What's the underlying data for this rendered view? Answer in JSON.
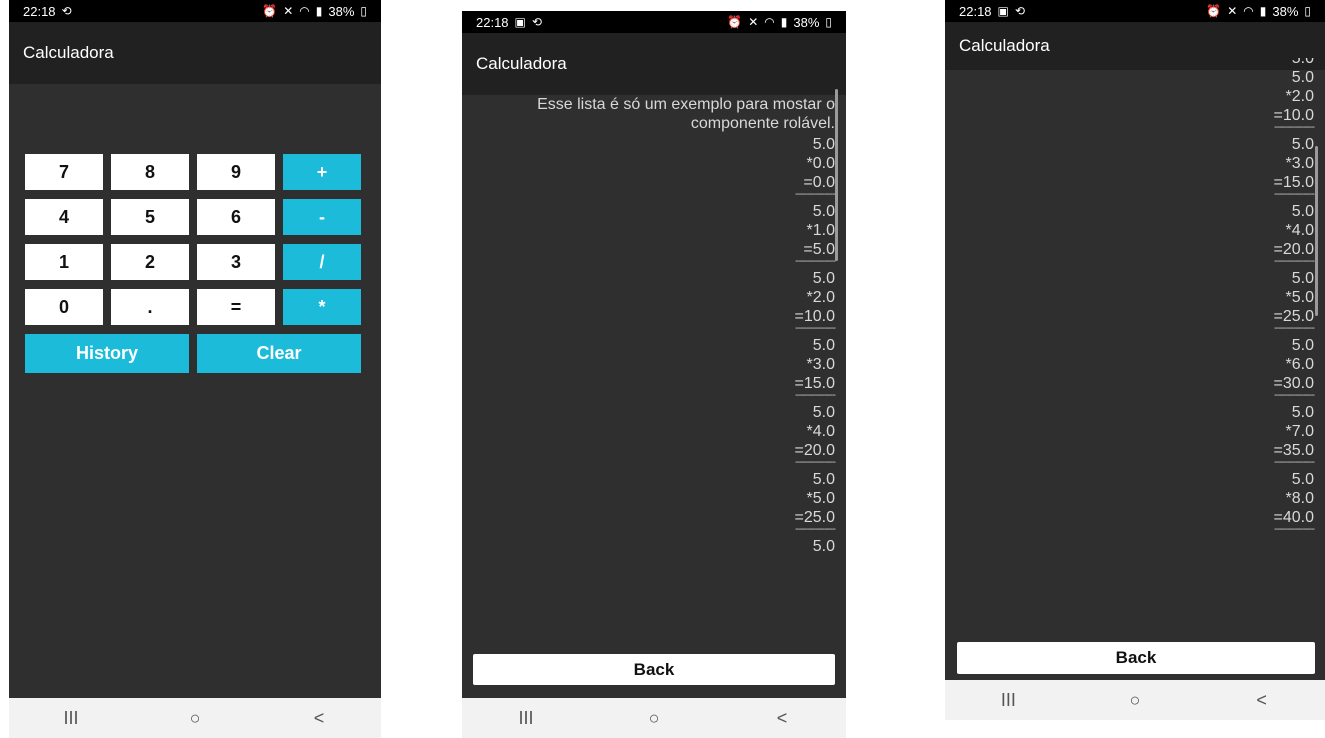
{
  "status": {
    "time": "22:18",
    "battery": "38%",
    "left_icons": [
      "sync-icon"
    ],
    "left_icons_history": [
      "gallery-icon",
      "sync-icon"
    ],
    "right_icons": [
      "alarm-icon",
      "mute-icon",
      "wifi-icon",
      "signal-icon",
      "battery-icon"
    ]
  },
  "app": {
    "title": "Calculadora"
  },
  "calculator": {
    "keys": [
      [
        "7",
        "8",
        "9",
        "+"
      ],
      [
        "4",
        "5",
        "6",
        "-"
      ],
      [
        "1",
        "2",
        "3",
        "/"
      ],
      [
        "0",
        ".",
        "=",
        "*"
      ]
    ],
    "history_label": "History",
    "clear_label": "Clear"
  },
  "history_screen_1": {
    "intro": "Esse lista é só um exemplo para mostar o componente rolável.",
    "entries": [
      {
        "a": "5.0",
        "b": "*0.0",
        "r": "=0.0",
        "sep": "---------------"
      },
      {
        "a": "5.0",
        "b": "*1.0",
        "r": "=5.0",
        "sep": "---------------"
      },
      {
        "a": "5.0",
        "b": "*2.0",
        "r": "=10.0",
        "sep": "---------------"
      },
      {
        "a": "5.0",
        "b": "*3.0",
        "r": "=15.0",
        "sep": "---------------"
      },
      {
        "a": "5.0",
        "b": "*4.0",
        "r": "=20.0",
        "sep": "---------------"
      },
      {
        "a": "5.0",
        "b": "*5.0",
        "r": "=25.0",
        "sep": "---------------"
      },
      {
        "a": "5.0"
      }
    ],
    "back_label": "Back"
  },
  "history_screen_2": {
    "entries": [
      {
        "a": "5.0",
        "b": "*2.0",
        "r": "=10.0",
        "sep": "---------------"
      },
      {
        "a": "5.0",
        "b": "*3.0",
        "r": "=15.0",
        "sep": "---------------"
      },
      {
        "a": "5.0",
        "b": "*4.0",
        "r": "=20.0",
        "sep": "---------------"
      },
      {
        "a": "5.0",
        "b": "*5.0",
        "r": "=25.0",
        "sep": "---------------"
      },
      {
        "a": "5.0",
        "b": "*6.0",
        "r": "=30.0",
        "sep": "---------------"
      },
      {
        "a": "5.0",
        "b": "*7.0",
        "r": "=35.0",
        "sep": "---------------"
      },
      {
        "a": "5.0",
        "b": "*8.0",
        "r": "=40.0",
        "sep": "---------------"
      }
    ],
    "back_label": "Back"
  },
  "navbar": {
    "recents": "III",
    "home": "○",
    "back": "<"
  },
  "colors": {
    "accent": "#1bbbd9",
    "background": "#2f2f2f",
    "appbar": "#212121"
  }
}
